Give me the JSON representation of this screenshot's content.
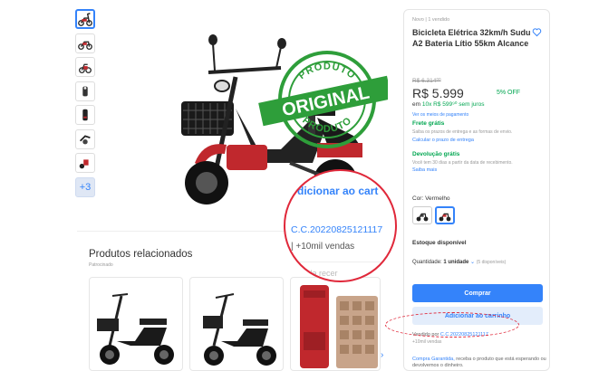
{
  "thumbnails": {
    "more_label": "+3"
  },
  "related": {
    "title": "Produtos relacionados",
    "subtitle": "Patrocinado"
  },
  "magnifier": {
    "add_label": "dicionar ao cart",
    "code": "C.C.20220825121117",
    "sales": "| +10mil vendas",
    "related_fragment": "tida   recer"
  },
  "stamp": {
    "top_text": "PRODUTO",
    "main_text": "ORIGINAL",
    "bottom_text": "PRODUTO"
  },
  "panel": {
    "condition": "Novo  |  1 vendido",
    "title": "Bicicleta Elétrica 32km/h Sudu A2 Bateria Lítio 55km Alcance",
    "old_price": "R$ 6.314⁰⁰",
    "price": "R$ 5.999",
    "off": "5% OFF",
    "installments_prefix": "em ",
    "installments_value": "10x R$ 599⁹⁰ sem juros",
    "payments_link": "Ver os meios de pagamento",
    "free_shipping": "Frete grátis",
    "free_shipping_desc": "Saiba os prazos de entrega e as formas de envio.",
    "calc_link": "Calcular o prazo de entrega",
    "free_return": "Devolução grátis",
    "free_return_desc": "Você tem 30 dias a partir da data de recebimento.",
    "more_link": "Saiba mais",
    "color_label": "Cor: Vermelho",
    "stock": "Estoque disponível",
    "qty_prefix": "Quantidade: ",
    "qty_value": "1 unidade",
    "qty_chevron": "⌄",
    "qty_available": "(5 disponíveis)",
    "buy_button": "Comprar",
    "cart_button": "Adicionar ao carrinho",
    "seller_prefix": "Vendido por ",
    "seller_name": "C.C.20220825121117",
    "seller_sub": "+10mil vendas",
    "guarantee_link": "Compra Garantida,",
    "guarantee_text": " receba o produto que está esperando ou devolvemos o dinheiro."
  },
  "colors": {
    "accent": "#3483fa",
    "green": "#00a650",
    "annotation_red": "#e0283a"
  }
}
